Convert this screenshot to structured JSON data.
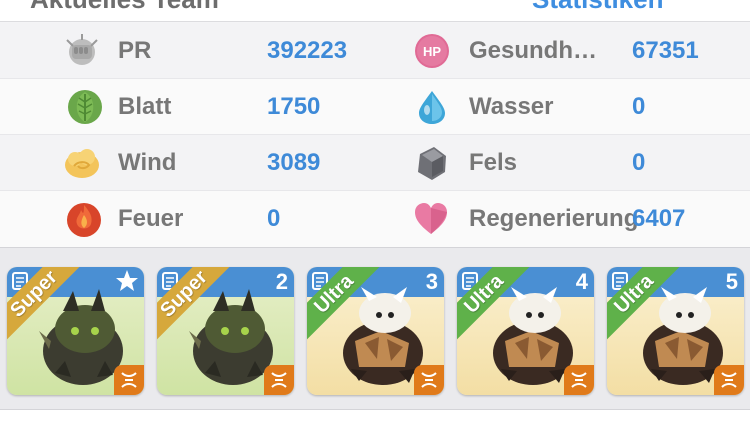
{
  "header": {
    "left_title": "Aktuelles Team",
    "right_link": "Statistiken"
  },
  "stats": [
    {
      "left": {
        "icon": "fist-icon",
        "label": "PR",
        "value": "392223"
      },
      "right": {
        "icon": "hp-icon",
        "icon_text": "HP",
        "label": "Gesundh…",
        "value": "67351"
      }
    },
    {
      "left": {
        "icon": "leaf-icon",
        "label": "Blatt",
        "value": "1750"
      },
      "right": {
        "icon": "water-drop-icon",
        "label": "Wasser",
        "value": "0"
      }
    },
    {
      "left": {
        "icon": "wind-icon",
        "label": "Wind",
        "value": "3089"
      },
      "right": {
        "icon": "rock-icon",
        "label": "Fels",
        "value": "0"
      }
    },
    {
      "left": {
        "icon": "fire-icon",
        "label": "Feuer",
        "value": "0"
      },
      "right": {
        "icon": "heart-icon",
        "label": "Regenerierung",
        "value": "6407"
      }
    }
  ],
  "monsters": [
    {
      "rank": "Super",
      "badge": "star",
      "number": "",
      "variant": "green-dragon"
    },
    {
      "rank": "Super",
      "badge": "number",
      "number": "2",
      "variant": "green-dragon"
    },
    {
      "rank": "Ultra",
      "badge": "number",
      "number": "3",
      "variant": "white-beast"
    },
    {
      "rank": "Ultra",
      "badge": "number",
      "number": "4",
      "variant": "white-beast"
    },
    {
      "rank": "Ultra",
      "badge": "number",
      "number": "5",
      "variant": "white-beast"
    }
  ],
  "colors": {
    "accent_blue": "#3e8ad8",
    "super_ribbon": "#d6a83c",
    "ultra_ribbon": "#5fb14a",
    "element_orange": "#e07a1a"
  }
}
